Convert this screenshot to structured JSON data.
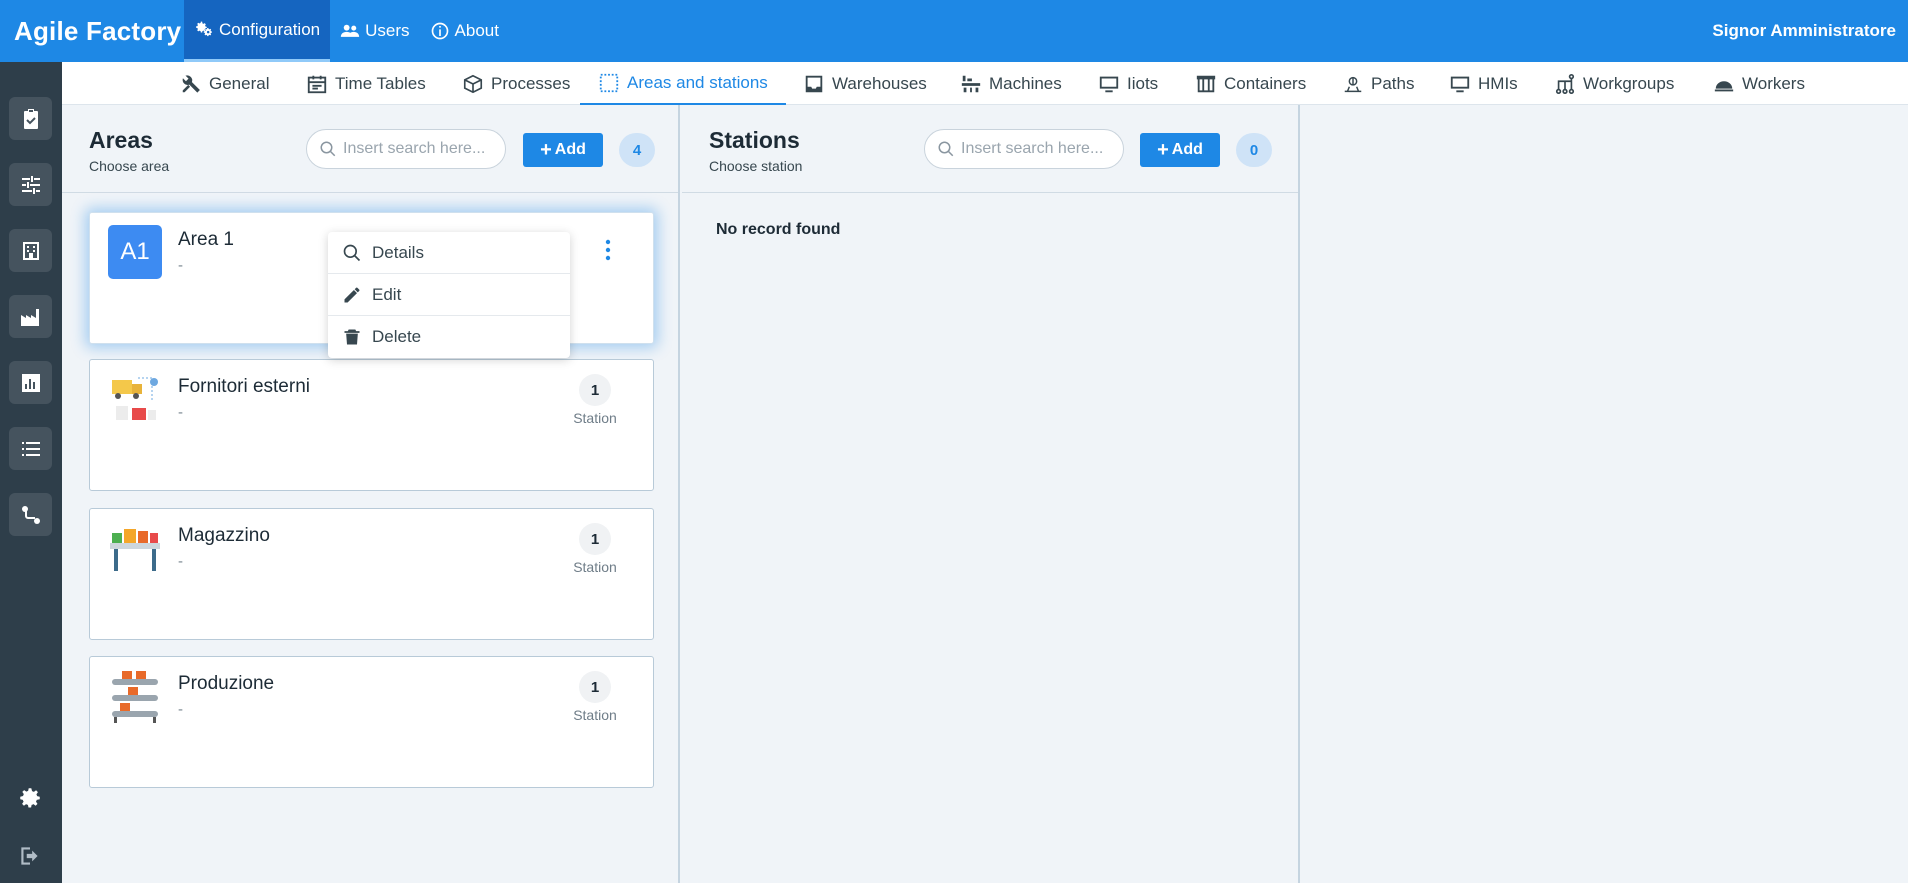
{
  "app": {
    "title": "Agile Factory",
    "user": "Signor Amministratore"
  },
  "topnav": [
    {
      "label": "Configuration",
      "icon": "gears-icon",
      "active": true
    },
    {
      "label": "Users",
      "icon": "users-icon",
      "active": false
    },
    {
      "label": "About",
      "icon": "info-icon",
      "active": false
    }
  ],
  "subnav": [
    {
      "label": "General",
      "icon": "tools-icon"
    },
    {
      "label": "Time Tables",
      "icon": "calendar-icon"
    },
    {
      "label": "Processes",
      "icon": "cube-icon"
    },
    {
      "label": "Areas and stations",
      "icon": "area-select-icon",
      "active": true
    },
    {
      "label": "Warehouses",
      "icon": "inbox-icon"
    },
    {
      "label": "Machines",
      "icon": "machine-icon"
    },
    {
      "label": "Iiots",
      "icon": "monitor-icon"
    },
    {
      "label": "Containers",
      "icon": "containers-icon"
    },
    {
      "label": "Paths",
      "icon": "paths-icon"
    },
    {
      "label": "HMIs",
      "icon": "monitor-icon"
    },
    {
      "label": "Workgroups",
      "icon": "workgroups-icon"
    },
    {
      "label": "Workers",
      "icon": "hardhat-icon"
    }
  ],
  "areas": {
    "title": "Areas",
    "subtitle": "Choose area",
    "search_placeholder": "Insert search here...",
    "add_label": "Add",
    "count": "4",
    "items": [
      {
        "initials": "A1",
        "name": "Area 1",
        "desc": "-"
      },
      {
        "name": "Fornitori esterni",
        "desc": "-",
        "count": "1",
        "count_label": "Station"
      },
      {
        "name": "Magazzino",
        "desc": "-",
        "count": "1",
        "count_label": "Station"
      },
      {
        "name": "Produzione",
        "desc": "-",
        "count": "1",
        "count_label": "Station"
      }
    ]
  },
  "menu": {
    "details": "Details",
    "edit": "Edit",
    "delete": "Delete"
  },
  "stations": {
    "title": "Stations",
    "subtitle": "Choose station",
    "search_placeholder": "Insert search here...",
    "add_label": "Add",
    "count": "0",
    "empty": "No record found"
  },
  "colors": {
    "primary": "#1e88e5",
    "sidebar": "#2e3e4a",
    "badge_bg": "#cfe3f7"
  }
}
